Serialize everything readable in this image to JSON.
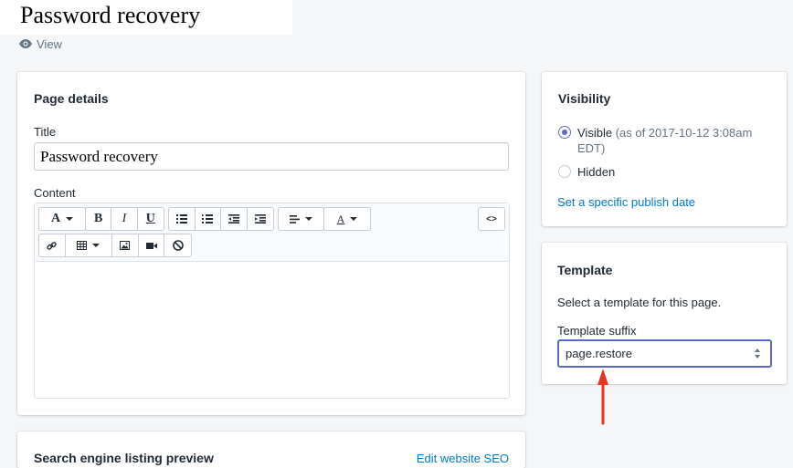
{
  "page": {
    "title": "Password recovery",
    "view_label": "View"
  },
  "page_details": {
    "heading": "Page details",
    "title_label": "Title",
    "title_value": "Password recovery",
    "content_label": "Content",
    "editor": {
      "row1": [
        "font-family-dropdown",
        "bold",
        "italic",
        "underline",
        "bullet-list",
        "numbered-list",
        "outdent",
        "indent",
        "align-dropdown",
        "text-color-dropdown",
        "html-source"
      ],
      "row2": [
        "link",
        "table-dropdown",
        "image",
        "video",
        "clear-formatting"
      ]
    }
  },
  "visibility": {
    "heading": "Visibility",
    "visible_label": "Visible",
    "visible_note": "(as of 2017-10-12 3:08am",
    "visible_note_tz": "EDT)",
    "hidden_label": "Hidden",
    "selected": "visible",
    "publish_link": "Set a specific publish date"
  },
  "template": {
    "heading": "Template",
    "description": "Select a template for this page.",
    "suffix_label": "Template suffix",
    "suffix_value": "page.restore"
  },
  "seo": {
    "heading": "Search engine listing preview",
    "edit_link": "Edit website SEO"
  },
  "colors": {
    "accent": "#5c6ac4",
    "link": "#007ace",
    "annotation_arrow": "#e8351f"
  }
}
